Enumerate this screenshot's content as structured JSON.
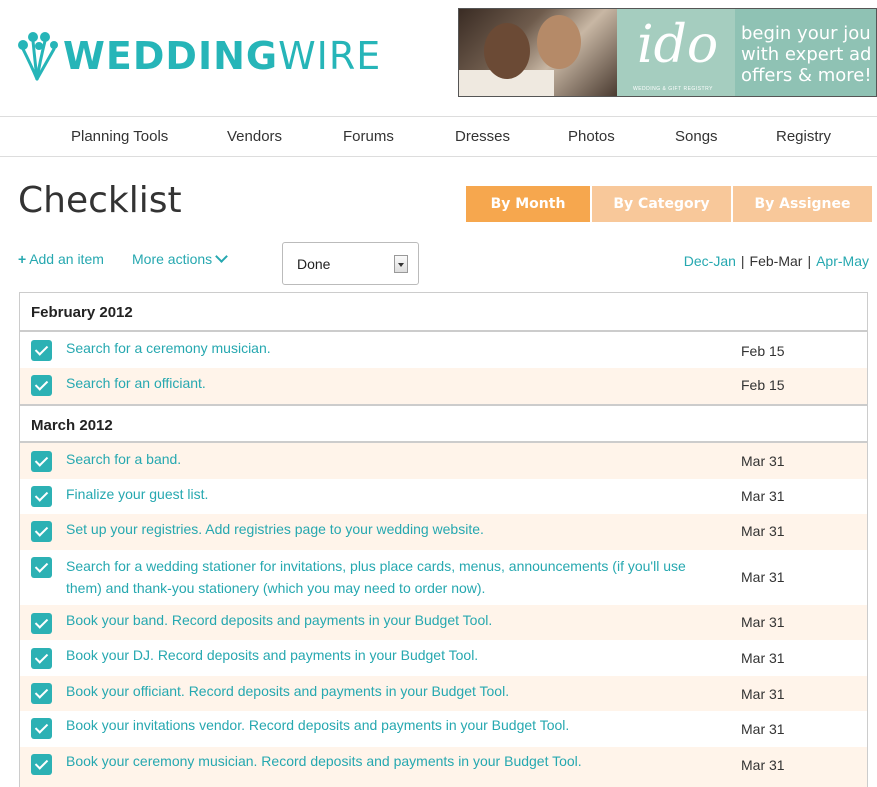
{
  "brand": {
    "logo_text_bold": "WEDDING",
    "logo_text_light": "WIRE"
  },
  "banner": {
    "ido": "ido",
    "ido_sub": "WEDDING & GIFT REGISTRY",
    "line1": "begin your jou",
    "line2": "with expert ad",
    "line3": "offers & more!"
  },
  "nav": {
    "items": [
      "Planning Tools",
      "Vendors",
      "Forums",
      "Dresses",
      "Photos",
      "Songs",
      "Registry"
    ]
  },
  "page": {
    "title": "Checklist"
  },
  "tabs": {
    "by_month": "By Month",
    "by_category": "By Category",
    "by_assignee": "By Assignee",
    "active": "By Month"
  },
  "toolbar": {
    "add_item": "Add an item",
    "add_icon": "plus-icon",
    "more_actions": "More actions",
    "filter_value": "Done"
  },
  "ranges": {
    "prev": "Dec-Jan",
    "current": "Feb-Mar",
    "next": "Apr-May"
  },
  "colors": {
    "accent": "#26a8b0",
    "tab_active": "#f6a74e",
    "tab_inactive": "#f8c89a",
    "row_alt": "#fff4ea",
    "checkbox": "#2cb1b4"
  },
  "groups": [
    {
      "month": "February 2012",
      "items": [
        {
          "text": "Search for a ceremony musician.",
          "due": "Feb 15",
          "done": true
        },
        {
          "text": "Search for an officiant.",
          "due": "Feb 15",
          "done": true
        }
      ]
    },
    {
      "month": "March 2012",
      "items": [
        {
          "text": "Search for a band.",
          "due": "Mar 31",
          "done": true
        },
        {
          "text": "Finalize your guest list.",
          "due": "Mar 31",
          "done": true
        },
        {
          "text": "Set up your registries. Add registries page to your wedding website.",
          "due": "Mar 31",
          "done": true
        },
        {
          "text": "Search for a wedding stationer for invitations, plus place cards, menus, announcements (if you'll use them) and thank-you stationery (which you may need to order now).",
          "due": "Mar 31",
          "done": true
        },
        {
          "text": "Book your band. Record deposits and payments in your Budget Tool.",
          "due": "Mar 31",
          "done": true
        },
        {
          "text": "Book your DJ. Record deposits and payments in your Budget Tool.",
          "due": "Mar 31",
          "done": true
        },
        {
          "text": "Book your officiant. Record deposits and payments in your Budget Tool.",
          "due": "Mar 31",
          "done": true
        },
        {
          "text": "Book your invitations vendor. Record deposits and payments in your Budget Tool.",
          "due": "Mar 31",
          "done": true
        },
        {
          "text": "Book your ceremony musician. Record deposits and payments in your Budget Tool.",
          "due": "Mar 31",
          "done": true
        }
      ]
    }
  ]
}
